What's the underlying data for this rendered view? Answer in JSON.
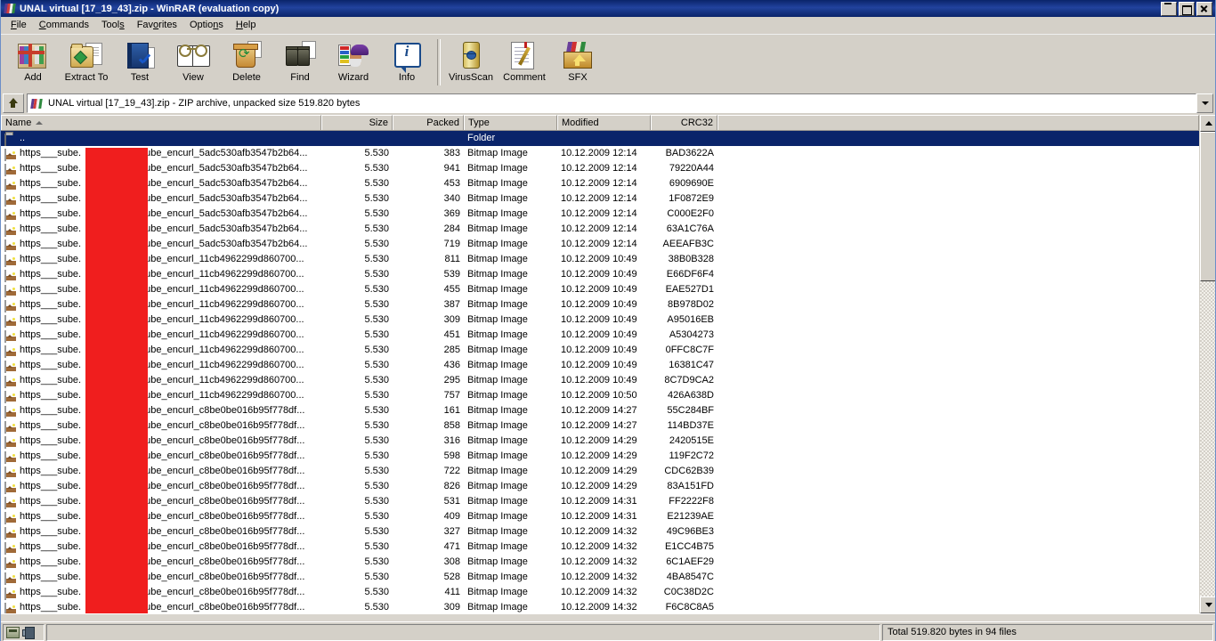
{
  "window": {
    "title": "UNAL virtual [17_19_43].zip - WinRAR (evaluation copy)",
    "app_icon": "winrar-icon",
    "controls": {
      "minimize": "Minimize",
      "restore": "Restore",
      "close": "Close"
    }
  },
  "menu": [
    {
      "label": "File",
      "accel": "F"
    },
    {
      "label": "Commands",
      "accel": "C"
    },
    {
      "label": "Tools",
      "accel": "s"
    },
    {
      "label": "Favorites",
      "accel": "o"
    },
    {
      "label": "Options",
      "accel": "n"
    },
    {
      "label": "Help",
      "accel": "H"
    }
  ],
  "toolbar": {
    "buttons": [
      {
        "label": "Add",
        "icon": "add-archive-icon"
      },
      {
        "label": "Extract To",
        "icon": "extract-to-icon"
      },
      {
        "label": "Test",
        "icon": "test-archive-icon"
      },
      {
        "label": "View",
        "icon": "view-file-icon"
      },
      {
        "label": "Delete",
        "icon": "delete-icon"
      },
      {
        "label": "Find",
        "icon": "find-binoculars-icon"
      },
      {
        "label": "Wizard",
        "icon": "wizard-icon"
      },
      {
        "label": "Info",
        "icon": "info-icon"
      },
      {
        "label": "VirusScan",
        "icon": "virusscan-icon"
      },
      {
        "label": "Comment",
        "icon": "comment-icon"
      },
      {
        "label": "SFX",
        "icon": "sfx-icon"
      }
    ]
  },
  "address": {
    "up_button": "up-one-level",
    "icon": "archive-icon",
    "text": "UNAL virtual [17_19_43].zip - ZIP archive, unpacked size 519.820 bytes",
    "dropdown": "history-dropdown"
  },
  "columns": [
    {
      "key": "name",
      "label": "Name",
      "sorted": "asc"
    },
    {
      "key": "size",
      "label": "Size"
    },
    {
      "key": "packed",
      "label": "Packed"
    },
    {
      "key": "type",
      "label": "Type"
    },
    {
      "key": "modified",
      "label": "Modified"
    },
    {
      "key": "crc",
      "label": "CRC32"
    }
  ],
  "redaction": {
    "color": "#f01e1e",
    "label": "redacted-filename-overlay"
  },
  "rows": [
    {
      "icon": "folder-up-icon",
      "name": "..",
      "size": "",
      "packed": "",
      "type": "Folder",
      "modified": "",
      "crc": "",
      "selected": true
    },
    {
      "icon": "bitmap-icon",
      "name": "https___sube.",
      "name2": "_isube_encurl_5adc530afb3547b2b64...",
      "size": "5.530",
      "packed": "383",
      "type": "Bitmap Image",
      "modified": "10.12.2009 12:14",
      "crc": "BAD3622A"
    },
    {
      "icon": "bitmap-icon",
      "name": "https___sube.",
      "name2": "_isube_encurl_5adc530afb3547b2b64...",
      "size": "5.530",
      "packed": "941",
      "type": "Bitmap Image",
      "modified": "10.12.2009 12:14",
      "crc": "79220A44"
    },
    {
      "icon": "bitmap-icon",
      "name": "https___sube.",
      "name2": "_isube_encurl_5adc530afb3547b2b64...",
      "size": "5.530",
      "packed": "453",
      "type": "Bitmap Image",
      "modified": "10.12.2009 12:14",
      "crc": "6909690E"
    },
    {
      "icon": "bitmap-icon",
      "name": "https___sube.",
      "name2": "_isube_encurl_5adc530afb3547b2b64...",
      "size": "5.530",
      "packed": "340",
      "type": "Bitmap Image",
      "modified": "10.12.2009 12:14",
      "crc": "1F0872E9"
    },
    {
      "icon": "bitmap-icon",
      "name": "https___sube.",
      "name2": "_isube_encurl_5adc530afb3547b2b64...",
      "size": "5.530",
      "packed": "369",
      "type": "Bitmap Image",
      "modified": "10.12.2009 12:14",
      "crc": "C000E2F0"
    },
    {
      "icon": "bitmap-icon",
      "name": "https___sube.",
      "name2": "_isube_encurl_5adc530afb3547b2b64...",
      "size": "5.530",
      "packed": "284",
      "type": "Bitmap Image",
      "modified": "10.12.2009 12:14",
      "crc": "63A1C76A"
    },
    {
      "icon": "bitmap-icon",
      "name": "https___sube.",
      "name2": "_isube_encurl_5adc530afb3547b2b64...",
      "size": "5.530",
      "packed": "719",
      "type": "Bitmap Image",
      "modified": "10.12.2009 12:14",
      "crc": "AEEAFB3C"
    },
    {
      "icon": "bitmap-icon",
      "name": "https___sube.",
      "name2": "_isube_encurl_11cb4962299d860700...",
      "size": "5.530",
      "packed": "811",
      "type": "Bitmap Image",
      "modified": "10.12.2009 10:49",
      "crc": "38B0B328"
    },
    {
      "icon": "bitmap-icon",
      "name": "https___sube.",
      "name2": "_isube_encurl_11cb4962299d860700...",
      "size": "5.530",
      "packed": "539",
      "type": "Bitmap Image",
      "modified": "10.12.2009 10:49",
      "crc": "E66DF6F4"
    },
    {
      "icon": "bitmap-icon",
      "name": "https___sube.",
      "name2": "_isube_encurl_11cb4962299d860700...",
      "size": "5.530",
      "packed": "455",
      "type": "Bitmap Image",
      "modified": "10.12.2009 10:49",
      "crc": "EAE527D1"
    },
    {
      "icon": "bitmap-icon",
      "name": "https___sube.",
      "name2": "_isube_encurl_11cb4962299d860700...",
      "size": "5.530",
      "packed": "387",
      "type": "Bitmap Image",
      "modified": "10.12.2009 10:49",
      "crc": "8B978D02"
    },
    {
      "icon": "bitmap-icon",
      "name": "https___sube.",
      "name2": "_isube_encurl_11cb4962299d860700...",
      "size": "5.530",
      "packed": "309",
      "type": "Bitmap Image",
      "modified": "10.12.2009 10:49",
      "crc": "A95016EB"
    },
    {
      "icon": "bitmap-icon",
      "name": "https___sube.",
      "name2": "_isube_encurl_11cb4962299d860700...",
      "size": "5.530",
      "packed": "451",
      "type": "Bitmap Image",
      "modified": "10.12.2009 10:49",
      "crc": "A5304273"
    },
    {
      "icon": "bitmap-icon",
      "name": "https___sube.",
      "name2": "_isube_encurl_11cb4962299d860700...",
      "size": "5.530",
      "packed": "285",
      "type": "Bitmap Image",
      "modified": "10.12.2009 10:49",
      "crc": "0FFC8C7F"
    },
    {
      "icon": "bitmap-icon",
      "name": "https___sube.",
      "name2": "_isube_encurl_11cb4962299d860700...",
      "size": "5.530",
      "packed": "436",
      "type": "Bitmap Image",
      "modified": "10.12.2009 10:49",
      "crc": "16381C47"
    },
    {
      "icon": "bitmap-icon",
      "name": "https___sube.",
      "name2": "_isube_encurl_11cb4962299d860700...",
      "size": "5.530",
      "packed": "295",
      "type": "Bitmap Image",
      "modified": "10.12.2009 10:49",
      "crc": "8C7D9CA2"
    },
    {
      "icon": "bitmap-icon",
      "name": "https___sube.",
      "name2": "_isube_encurl_11cb4962299d860700...",
      "size": "5.530",
      "packed": "757",
      "type": "Bitmap Image",
      "modified": "10.12.2009 10:50",
      "crc": "426A638D"
    },
    {
      "icon": "bitmap-icon",
      "name": "https___sube.",
      "name2": "_isube_encurl_c8be0be016b95f778df...",
      "size": "5.530",
      "packed": "161",
      "type": "Bitmap Image",
      "modified": "10.12.2009 14:27",
      "crc": "55C284BF"
    },
    {
      "icon": "bitmap-icon",
      "name": "https___sube.",
      "name2": "_isube_encurl_c8be0be016b95f778df...",
      "size": "5.530",
      "packed": "858",
      "type": "Bitmap Image",
      "modified": "10.12.2009 14:27",
      "crc": "114BD37E"
    },
    {
      "icon": "bitmap-icon",
      "name": "https___sube.",
      "name2": "_isube_encurl_c8be0be016b95f778df...",
      "size": "5.530",
      "packed": "316",
      "type": "Bitmap Image",
      "modified": "10.12.2009 14:29",
      "crc": "2420515E"
    },
    {
      "icon": "bitmap-icon",
      "name": "https___sube.",
      "name2": "_isube_encurl_c8be0be016b95f778df...",
      "size": "5.530",
      "packed": "598",
      "type": "Bitmap Image",
      "modified": "10.12.2009 14:29",
      "crc": "119F2C72"
    },
    {
      "icon": "bitmap-icon",
      "name": "https___sube.",
      "name2": "_isube_encurl_c8be0be016b95f778df...",
      "size": "5.530",
      "packed": "722",
      "type": "Bitmap Image",
      "modified": "10.12.2009 14:29",
      "crc": "CDC62B39"
    },
    {
      "icon": "bitmap-icon",
      "name": "https___sube.",
      "name2": "_isube_encurl_c8be0be016b95f778df...",
      "size": "5.530",
      "packed": "826",
      "type": "Bitmap Image",
      "modified": "10.12.2009 14:29",
      "crc": "83A151FD"
    },
    {
      "icon": "bitmap-icon",
      "name": "https___sube.",
      "name2": "_isube_encurl_c8be0be016b95f778df...",
      "size": "5.530",
      "packed": "531",
      "type": "Bitmap Image",
      "modified": "10.12.2009 14:31",
      "crc": "FF2222F8"
    },
    {
      "icon": "bitmap-icon",
      "name": "https___sube.",
      "name2": "_isube_encurl_c8be0be016b95f778df...",
      "size": "5.530",
      "packed": "409",
      "type": "Bitmap Image",
      "modified": "10.12.2009 14:31",
      "crc": "E21239AE"
    },
    {
      "icon": "bitmap-icon",
      "name": "https___sube.",
      "name2": "_isube_encurl_c8be0be016b95f778df...",
      "size": "5.530",
      "packed": "327",
      "type": "Bitmap Image",
      "modified": "10.12.2009 14:32",
      "crc": "49C96BE3"
    },
    {
      "icon": "bitmap-icon",
      "name": "https___sube.",
      "name2": "_isube_encurl_c8be0be016b95f778df...",
      "size": "5.530",
      "packed": "471",
      "type": "Bitmap Image",
      "modified": "10.12.2009 14:32",
      "crc": "E1CC4B75"
    },
    {
      "icon": "bitmap-icon",
      "name": "https___sube.",
      "name2": "_isube_encurl_c8be0be016b95f778df...",
      "size": "5.530",
      "packed": "308",
      "type": "Bitmap Image",
      "modified": "10.12.2009 14:32",
      "crc": "6C1AEF29"
    },
    {
      "icon": "bitmap-icon",
      "name": "https___sube.",
      "name2": "_isube_encurl_c8be0be016b95f778df...",
      "size": "5.530",
      "packed": "528",
      "type": "Bitmap Image",
      "modified": "10.12.2009 14:32",
      "crc": "4BA8547C"
    },
    {
      "icon": "bitmap-icon",
      "name": "https___sube.",
      "name2": "_isube_encurl_c8be0be016b95f778df...",
      "size": "5.530",
      "packed": "411",
      "type": "Bitmap Image",
      "modified": "10.12.2009 14:32",
      "crc": "C0C38D2C"
    },
    {
      "icon": "bitmap-icon",
      "name": "https___sube.",
      "name2": "_isube_encurl_c8be0be016b95f778df...",
      "size": "5.530",
      "packed": "309",
      "type": "Bitmap Image",
      "modified": "10.12.2009 14:32",
      "crc": "F6C8C8A5"
    }
  ],
  "statusbar": {
    "disk_icon": "disk-icon",
    "key_icon": "key-icon",
    "total": "Total 519.820 bytes in 94 files"
  }
}
